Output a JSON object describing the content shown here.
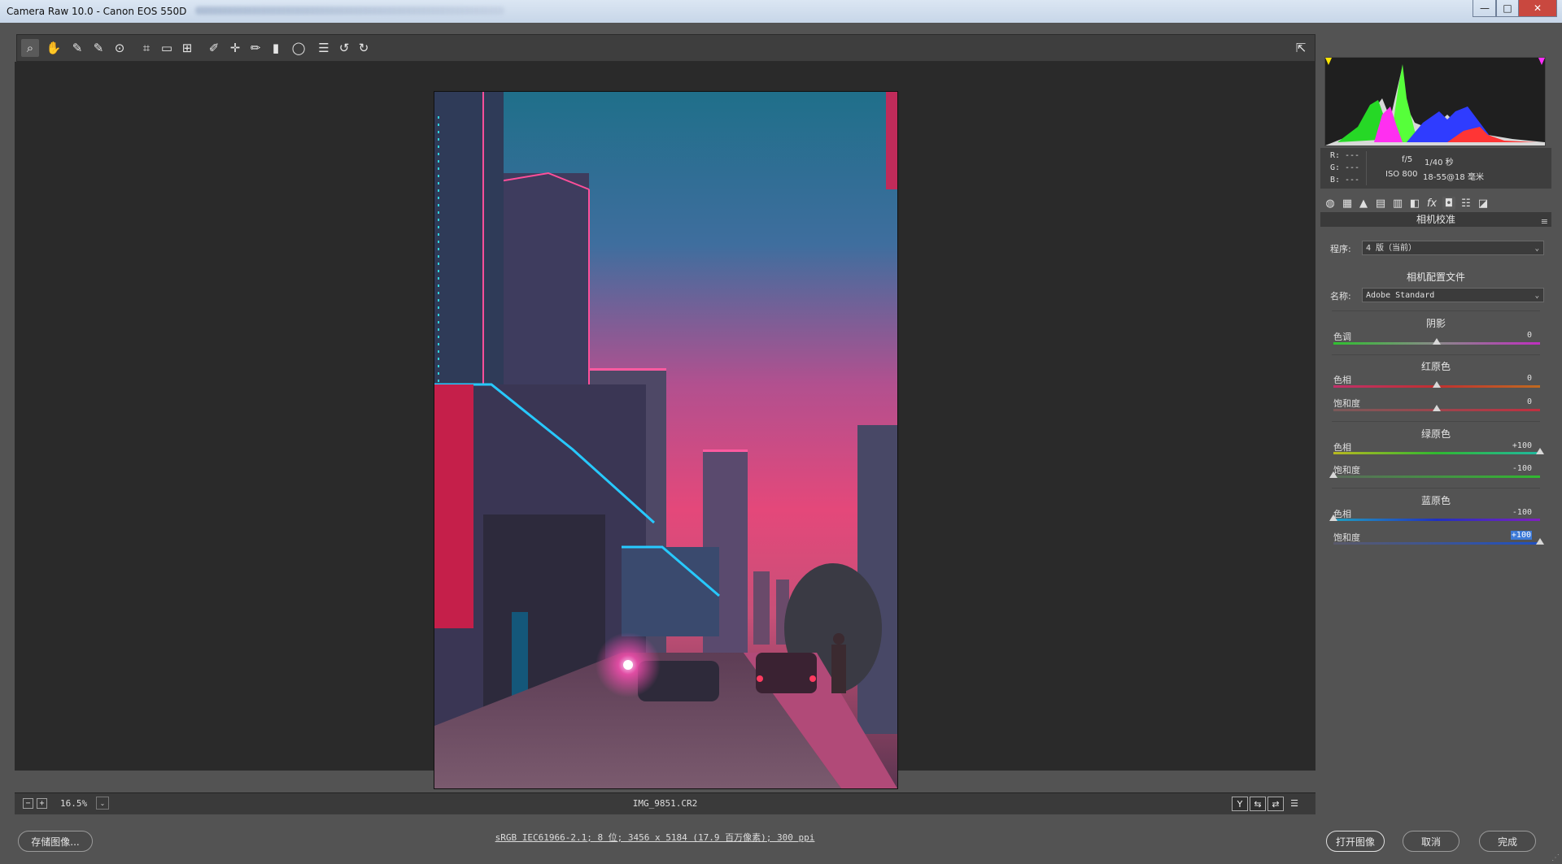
{
  "window": {
    "title": "Camera Raw 10.0 -  Canon EOS 550D",
    "minimize": "—",
    "maximize": "□",
    "close": "✕"
  },
  "toolbar": {
    "tools": [
      {
        "name": "zoom-tool",
        "glyph": "⌕",
        "active": true
      },
      {
        "name": "hand-tool",
        "glyph": "✋"
      },
      {
        "name": "white-balance-tool",
        "glyph": "✎"
      },
      {
        "name": "color-sampler-tool",
        "glyph": "✎"
      },
      {
        "name": "targeted-adjustment-tool",
        "glyph": "⊙"
      },
      {
        "name": "crop-tool",
        "glyph": "⌗"
      },
      {
        "name": "straighten-tool",
        "glyph": "▭"
      },
      {
        "name": "transform-tool",
        "glyph": "⊞"
      },
      {
        "name": "spot-removal-tool",
        "glyph": "✐"
      },
      {
        "name": "red-eye-tool",
        "glyph": "✛"
      },
      {
        "name": "adjustment-brush-tool",
        "glyph": "✏"
      },
      {
        "name": "graduated-filter-tool",
        "glyph": "▮"
      },
      {
        "name": "radial-filter-tool",
        "glyph": "◯"
      },
      {
        "name": "preferences-tool",
        "glyph": "☰"
      },
      {
        "name": "rotate-left-tool",
        "glyph": "↺"
      },
      {
        "name": "rotate-right-tool",
        "glyph": "↻"
      }
    ],
    "fullscreen_glyph": "⇱"
  },
  "status": {
    "zoom_out": "−",
    "zoom_in": "+",
    "zoom": "16.5%",
    "zoom_chevron": "⌄",
    "filename": "IMG_9851.CR2",
    "view_buttons": [
      "Y",
      "⇆",
      "⇄",
      "☰"
    ]
  },
  "histogram": {
    "r_label": "R:",
    "r_value": "---",
    "g_label": "G:",
    "g_value": "---",
    "b_label": "B:",
    "b_value": "---",
    "aperture": "f/5",
    "shutter": "1/40 秒",
    "iso": "ISO 800",
    "lens": "18-55@18 毫米"
  },
  "panel_icons": [
    "◍",
    "▦",
    "▲",
    "▤",
    "▥",
    "◧",
    "fx",
    "◘",
    "☷",
    "◪"
  ],
  "panel": {
    "title": "相机校准",
    "menu_icon": "≡",
    "process_label": "程序:",
    "process_value": "4 版（当前）",
    "profile_section": "相机配置文件",
    "name_label": "名称:",
    "name_value": "Adobe Standard",
    "chevron": "⌄",
    "shadows_section": "阴影",
    "shadows_tint_label": "色调",
    "shadows_tint_value": "0",
    "red_section": "红原色",
    "red_hue_label": "色相",
    "red_hue_value": "0",
    "red_sat_label": "饱和度",
    "red_sat_value": "0",
    "green_section": "绿原色",
    "green_hue_label": "色相",
    "green_hue_value": "+100",
    "green_sat_label": "饱和度",
    "green_sat_value": "-100",
    "blue_section": "蓝原色",
    "blue_hue_label": "色相",
    "blue_hue_value": "-100",
    "blue_sat_label": "饱和度",
    "blue_sat_value": "+100"
  },
  "sliders": {
    "shadows_tint": 0.5,
    "red_hue": 0.5,
    "red_sat": 0.5,
    "green_hue": 1.0,
    "green_sat": 0.0,
    "blue_hue": 0.0,
    "blue_sat": 1.0
  },
  "bottom": {
    "save_label": "存储图像...",
    "info": "sRGB IEC61966-2.1; 8 位; 3456 x 5184 (17.9 百万像素); 300 ppi",
    "open_label": "打开图像",
    "cancel_label": "取消",
    "done_label": "完成",
    "resize_glyph": "⋰"
  },
  "colors": {
    "accent": "#3d7ad8",
    "panel_bg": "#535353",
    "canvas_bg": "#2a2a2a"
  }
}
